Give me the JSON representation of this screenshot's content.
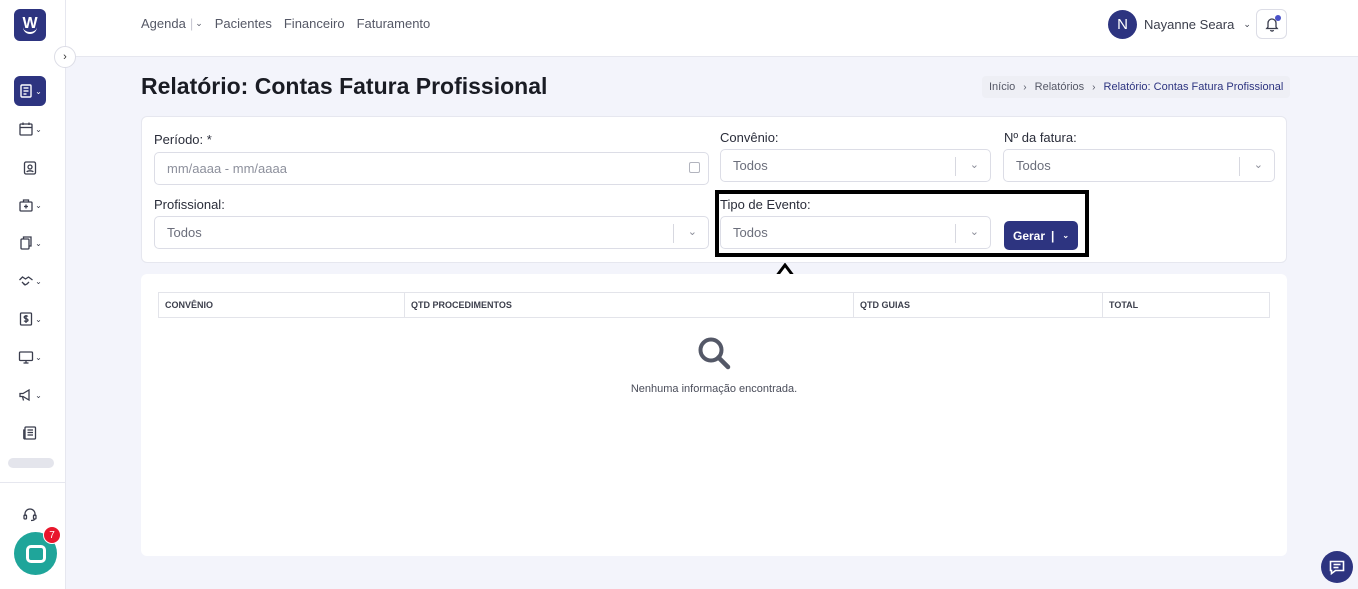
{
  "app": {
    "logo_text": "W"
  },
  "nav": {
    "items": [
      "Agenda",
      "Pacientes",
      "Financeiro",
      "Faturamento"
    ],
    "agenda_separator": "|"
  },
  "user": {
    "initial": "N",
    "name": "Nayanne Seara"
  },
  "page": {
    "title": "Relatório: Contas Fatura Profissional"
  },
  "breadcrumb": [
    "Início",
    "Relatórios",
    "Relatório: Contas Fatura Profissional"
  ],
  "filters": {
    "periodo": {
      "label": "Período: *",
      "placeholder": "mm/aaaa - mm/aaaa"
    },
    "convenio": {
      "label": "Convênio:",
      "value": "Todos"
    },
    "fatura": {
      "label": "Nº da fatura:",
      "value": "Todos"
    },
    "profissional": {
      "label": "Profissional:",
      "value": "Todos"
    },
    "tipo_evento": {
      "label": "Tipo de Evento:",
      "value": "Todos"
    },
    "gerar_label": "Gerar",
    "gerar_separator": "|"
  },
  "table": {
    "columns": [
      "CONVÊNIO",
      "QTD PROCEDIMENTOS",
      "QTD GUIAS",
      "TOTAL"
    ],
    "rows": [],
    "empty_message": "Nenhuma informação encontrada."
  },
  "chat": {
    "badge_count": "7"
  },
  "colors": {
    "primary": "#2d3480",
    "chat": "#1fa59a",
    "badge": "#e8172c"
  },
  "icons": {
    "sidebar": [
      "reports-icon",
      "calendar-icon",
      "patient-icon",
      "medical-bag-icon",
      "documents-icon",
      "handshake-icon",
      "billing-icon",
      "monitor-icon",
      "megaphone-icon",
      "news-icon",
      "headset-icon"
    ]
  }
}
